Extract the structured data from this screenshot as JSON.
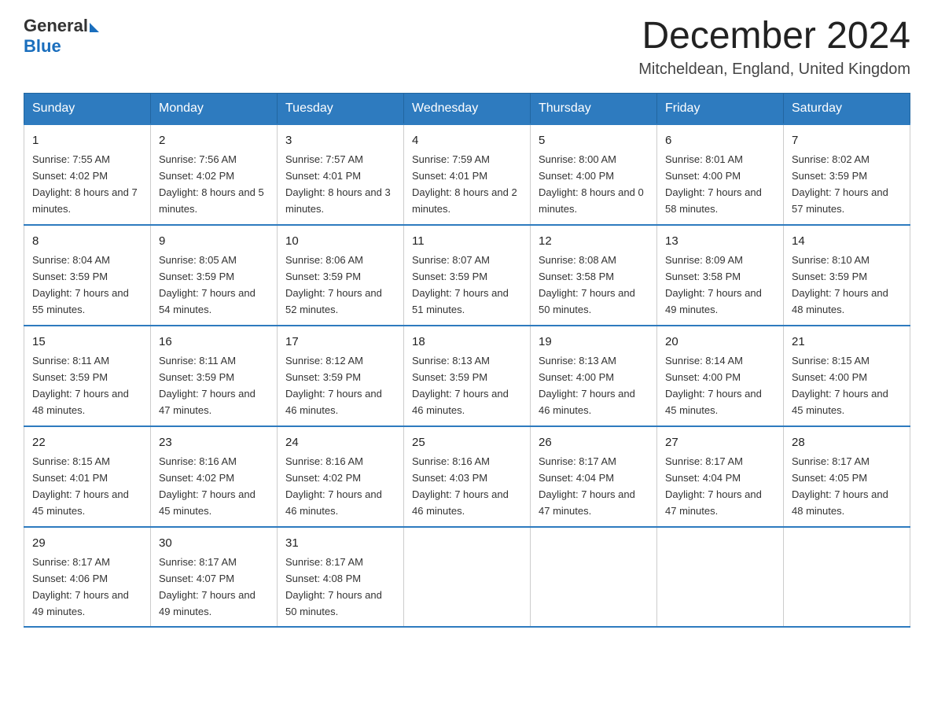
{
  "header": {
    "logo_general": "General",
    "logo_blue": "Blue",
    "month_title": "December 2024",
    "location": "Mitcheldean, England, United Kingdom"
  },
  "days_of_week": [
    "Sunday",
    "Monday",
    "Tuesday",
    "Wednesday",
    "Thursday",
    "Friday",
    "Saturday"
  ],
  "weeks": [
    [
      {
        "day": "1",
        "sunrise": "7:55 AM",
        "sunset": "4:02 PM",
        "daylight": "8 hours and 7 minutes."
      },
      {
        "day": "2",
        "sunrise": "7:56 AM",
        "sunset": "4:02 PM",
        "daylight": "8 hours and 5 minutes."
      },
      {
        "day": "3",
        "sunrise": "7:57 AM",
        "sunset": "4:01 PM",
        "daylight": "8 hours and 3 minutes."
      },
      {
        "day": "4",
        "sunrise": "7:59 AM",
        "sunset": "4:01 PM",
        "daylight": "8 hours and 2 minutes."
      },
      {
        "day": "5",
        "sunrise": "8:00 AM",
        "sunset": "4:00 PM",
        "daylight": "8 hours and 0 minutes."
      },
      {
        "day": "6",
        "sunrise": "8:01 AM",
        "sunset": "4:00 PM",
        "daylight": "7 hours and 58 minutes."
      },
      {
        "day": "7",
        "sunrise": "8:02 AM",
        "sunset": "3:59 PM",
        "daylight": "7 hours and 57 minutes."
      }
    ],
    [
      {
        "day": "8",
        "sunrise": "8:04 AM",
        "sunset": "3:59 PM",
        "daylight": "7 hours and 55 minutes."
      },
      {
        "day": "9",
        "sunrise": "8:05 AM",
        "sunset": "3:59 PM",
        "daylight": "7 hours and 54 minutes."
      },
      {
        "day": "10",
        "sunrise": "8:06 AM",
        "sunset": "3:59 PM",
        "daylight": "7 hours and 52 minutes."
      },
      {
        "day": "11",
        "sunrise": "8:07 AM",
        "sunset": "3:59 PM",
        "daylight": "7 hours and 51 minutes."
      },
      {
        "day": "12",
        "sunrise": "8:08 AM",
        "sunset": "3:58 PM",
        "daylight": "7 hours and 50 minutes."
      },
      {
        "day": "13",
        "sunrise": "8:09 AM",
        "sunset": "3:58 PM",
        "daylight": "7 hours and 49 minutes."
      },
      {
        "day": "14",
        "sunrise": "8:10 AM",
        "sunset": "3:59 PM",
        "daylight": "7 hours and 48 minutes."
      }
    ],
    [
      {
        "day": "15",
        "sunrise": "8:11 AM",
        "sunset": "3:59 PM",
        "daylight": "7 hours and 48 minutes."
      },
      {
        "day": "16",
        "sunrise": "8:11 AM",
        "sunset": "3:59 PM",
        "daylight": "7 hours and 47 minutes."
      },
      {
        "day": "17",
        "sunrise": "8:12 AM",
        "sunset": "3:59 PM",
        "daylight": "7 hours and 46 minutes."
      },
      {
        "day": "18",
        "sunrise": "8:13 AM",
        "sunset": "3:59 PM",
        "daylight": "7 hours and 46 minutes."
      },
      {
        "day": "19",
        "sunrise": "8:13 AM",
        "sunset": "4:00 PM",
        "daylight": "7 hours and 46 minutes."
      },
      {
        "day": "20",
        "sunrise": "8:14 AM",
        "sunset": "4:00 PM",
        "daylight": "7 hours and 45 minutes."
      },
      {
        "day": "21",
        "sunrise": "8:15 AM",
        "sunset": "4:00 PM",
        "daylight": "7 hours and 45 minutes."
      }
    ],
    [
      {
        "day": "22",
        "sunrise": "8:15 AM",
        "sunset": "4:01 PM",
        "daylight": "7 hours and 45 minutes."
      },
      {
        "day": "23",
        "sunrise": "8:16 AM",
        "sunset": "4:02 PM",
        "daylight": "7 hours and 45 minutes."
      },
      {
        "day": "24",
        "sunrise": "8:16 AM",
        "sunset": "4:02 PM",
        "daylight": "7 hours and 46 minutes."
      },
      {
        "day": "25",
        "sunrise": "8:16 AM",
        "sunset": "4:03 PM",
        "daylight": "7 hours and 46 minutes."
      },
      {
        "day": "26",
        "sunrise": "8:17 AM",
        "sunset": "4:04 PM",
        "daylight": "7 hours and 47 minutes."
      },
      {
        "day": "27",
        "sunrise": "8:17 AM",
        "sunset": "4:04 PM",
        "daylight": "7 hours and 47 minutes."
      },
      {
        "day": "28",
        "sunrise": "8:17 AM",
        "sunset": "4:05 PM",
        "daylight": "7 hours and 48 minutes."
      }
    ],
    [
      {
        "day": "29",
        "sunrise": "8:17 AM",
        "sunset": "4:06 PM",
        "daylight": "7 hours and 49 minutes."
      },
      {
        "day": "30",
        "sunrise": "8:17 AM",
        "sunset": "4:07 PM",
        "daylight": "7 hours and 49 minutes."
      },
      {
        "day": "31",
        "sunrise": "8:17 AM",
        "sunset": "4:08 PM",
        "daylight": "7 hours and 50 minutes."
      },
      null,
      null,
      null,
      null
    ]
  ],
  "labels": {
    "sunrise_prefix": "Sunrise: ",
    "sunset_prefix": "Sunset: ",
    "daylight_prefix": "Daylight: "
  }
}
